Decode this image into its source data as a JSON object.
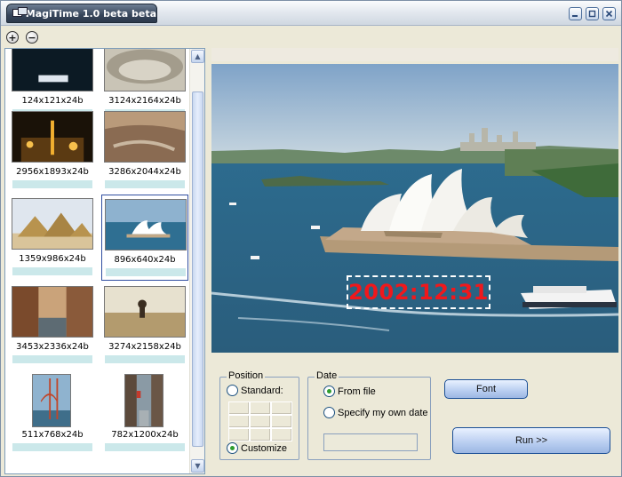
{
  "window": {
    "title": "MagiTime 1.0 beta beta",
    "buttons": {
      "minimize_icon": "minimize-icon",
      "restore_icon": "restore-icon",
      "close_icon": "close-icon"
    }
  },
  "toolbar": {
    "add_icon": "+",
    "remove_icon": "−"
  },
  "thumbnails": [
    {
      "caption": "124x121x24b",
      "scene": "dark-cover"
    },
    {
      "caption": "3124x2164x24b",
      "scene": "ruins"
    },
    {
      "caption": "2956x1893x24b",
      "scene": "night-city"
    },
    {
      "caption": "3286x2044x24b",
      "scene": "canyon"
    },
    {
      "caption": "1359x986x24b",
      "scene": "pyramids"
    },
    {
      "caption": "896x640x24b",
      "scene": "opera-house",
      "selected": true
    },
    {
      "caption": "3453x2336x24b",
      "scene": "street"
    },
    {
      "caption": "3274x2158x24b",
      "scene": "savanna"
    },
    {
      "caption": "511x768x24b",
      "scene": "bridge"
    },
    {
      "caption": "782x1200x24b",
      "scene": "alley"
    }
  ],
  "preview": {
    "date_stamp": "2002:12:31",
    "stamp_color": "#f0181c"
  },
  "position_group": {
    "label": "Position",
    "standard_label": "Standard:",
    "customize_label": "Customize",
    "selected": "customize"
  },
  "date_group": {
    "label": "Date",
    "from_file_label": "From file",
    "own_date_label": "Specify my own date",
    "selected": "from_file",
    "own_date_value": ""
  },
  "actions": {
    "font_label": "Font",
    "run_label": "Run >>"
  },
  "colors": {
    "accent": "#1b4f96",
    "thumb_bar": "#cbe8ea",
    "window_bg": "#ece9d8"
  }
}
